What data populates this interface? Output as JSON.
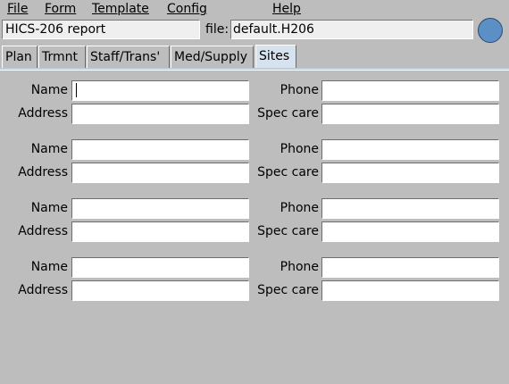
{
  "menubar": {
    "file": "File",
    "form": "Form",
    "template": "Template",
    "config": "Config",
    "help": "Help"
  },
  "header": {
    "report_title": "HICS-206 report",
    "file_label": "file:",
    "file_name": "default.H206",
    "status_light_color": "#5b8fc5"
  },
  "tabs": [
    "Plan",
    "Trmnt",
    "Staff/Trans'",
    "Med/Supply",
    "Sites"
  ],
  "active_tab": "Sites",
  "sites": {
    "labels": {
      "name": "Name",
      "address": "Address",
      "phone": "Phone",
      "spec_care": "Spec care"
    },
    "entries": [
      {
        "name": "",
        "address": "",
        "phone": "",
        "spec_care": ""
      },
      {
        "name": "",
        "address": "",
        "phone": "",
        "spec_care": ""
      },
      {
        "name": "",
        "address": "",
        "phone": "",
        "spec_care": ""
      },
      {
        "name": "",
        "address": "",
        "phone": "",
        "spec_care": ""
      }
    ]
  }
}
